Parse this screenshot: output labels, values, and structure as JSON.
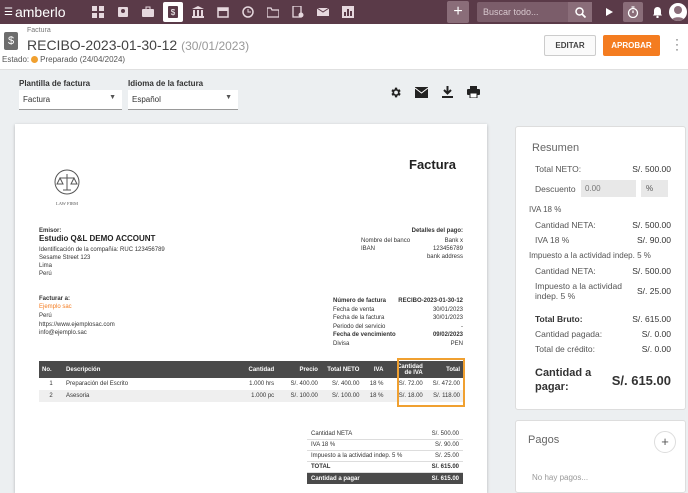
{
  "app": {
    "name": "amberlo"
  },
  "topbar": {
    "search_placeholder": "Buscar todo..."
  },
  "header": {
    "breadcrumb": "Factura",
    "title": "RECIBO-2023-01-30-12",
    "title_date": "(30/01/2023)",
    "status_label": "Estado:",
    "status_value": "Preparado (24/04/2024)",
    "status_color": "#f0a030",
    "edit_label": "EDITAR",
    "approve_label": "APROBAR"
  },
  "filters": {
    "template_label": "Plantilla de factura",
    "template_value": "Factura",
    "language_label": "Idioma de la factura",
    "language_value": "Español"
  },
  "invoice": {
    "title": "Factura",
    "logo_text": "LAW FIRM",
    "issuer_label": "Emisor:",
    "issuer_name": "Estudio Q&L DEMO ACCOUNT",
    "issuer_lines": [
      "Identificación de la compañía: RUC 123456789",
      "Sesame Street 123",
      "Lima",
      "Perú"
    ],
    "payment": {
      "title": "Detalles del pago:",
      "rows": [
        {
          "label": "Nombre del banco",
          "value": "Bank x"
        },
        {
          "label": "IBAN",
          "value": "123456789"
        },
        {
          "label": "",
          "value": "bank address"
        }
      ]
    },
    "billto_label": "Facturar a:",
    "billto_name": "Ejemplo sac",
    "billto_lines": [
      "Perú",
      "https://www.ejemplosac.com",
      "info@ejemplo.sac"
    ],
    "meta": [
      {
        "label": "Número de factura",
        "value": "RECIBO-2023-01-30-12",
        "bold": true
      },
      {
        "label": "Fecha de venta",
        "value": "30/01/2023"
      },
      {
        "label": "Fecha de la factura",
        "value": "30/01/2023"
      },
      {
        "label": "Periodo del servicio",
        "value": "-"
      },
      {
        "label": "Fecha de vencimiento",
        "value": "09/02/2023",
        "bold": true
      },
      {
        "label": "Divisa",
        "value": "PEN"
      }
    ],
    "columns": [
      "No.",
      "Descripción",
      "Cantidad",
      "Precio",
      "Total NETO",
      "IVA",
      "Cantidad de IVA",
      "Total"
    ],
    "items": [
      [
        "1",
        "Preparación del Escrito",
        "1.000 hrs",
        "S/. 400.00",
        "S/. 400.00",
        "18 %",
        "S/. 72.00",
        "S/. 472.00"
      ],
      [
        "2",
        "Asesoria",
        "1.000 pc",
        "S/. 100.00",
        "S/. 100.00",
        "18 %",
        "S/. 18.00",
        "S/. 118.00"
      ]
    ],
    "totals": [
      {
        "label": "Cantidad NETA",
        "value": "S/. 500.00"
      },
      {
        "label": "IVA 18 %",
        "value": "S/. 90.00"
      },
      {
        "label": "Impuesto a la actividad indep. 5 %",
        "value": "S/. 25.00"
      },
      {
        "label": "TOTAL",
        "value": "S/. 615.00",
        "style": "bold"
      },
      {
        "label": "Cantidad a pagar",
        "value": "S/. 615.00",
        "style": "dark"
      }
    ]
  },
  "summary": {
    "title": "Resumen",
    "total_neto_label": "Total NETO:",
    "total_neto_value": "S/. 500.00",
    "discount_label": "Descuento",
    "discount_value": "0.00",
    "discount_unit": "%",
    "iva_section": "IVA 18 %",
    "iva_neta_label": "Cantidad NETA:",
    "iva_neta_value": "S/. 500.00",
    "iva_label": "IVA 18 %",
    "iva_value": "S/. 90.00",
    "tax_section": "Impuesto a la actividad indep. 5 %",
    "tax_neta_label": "Cantidad NETA:",
    "tax_neta_value": "S/. 500.00",
    "tax_label": "Impuesto a la actividad indep. 5 %",
    "tax_value": "S/. 25.00",
    "gross_label": "Total Bruto:",
    "gross_value": "S/. 615.00",
    "paid_label": "Cantidad pagada:",
    "paid_value": "S/. 0.00",
    "credit_label": "Total de crédito:",
    "credit_value": "S/. 0.00",
    "due_label": "Cantidad a pagar:",
    "due_value": "S/. 615.00"
  },
  "payments": {
    "title": "Pagos",
    "add": "+",
    "empty": "No hay pagos..."
  },
  "colors": {
    "topbar": "#5a3a48",
    "accent": "#f47c20",
    "highlight": "#f0a030"
  }
}
